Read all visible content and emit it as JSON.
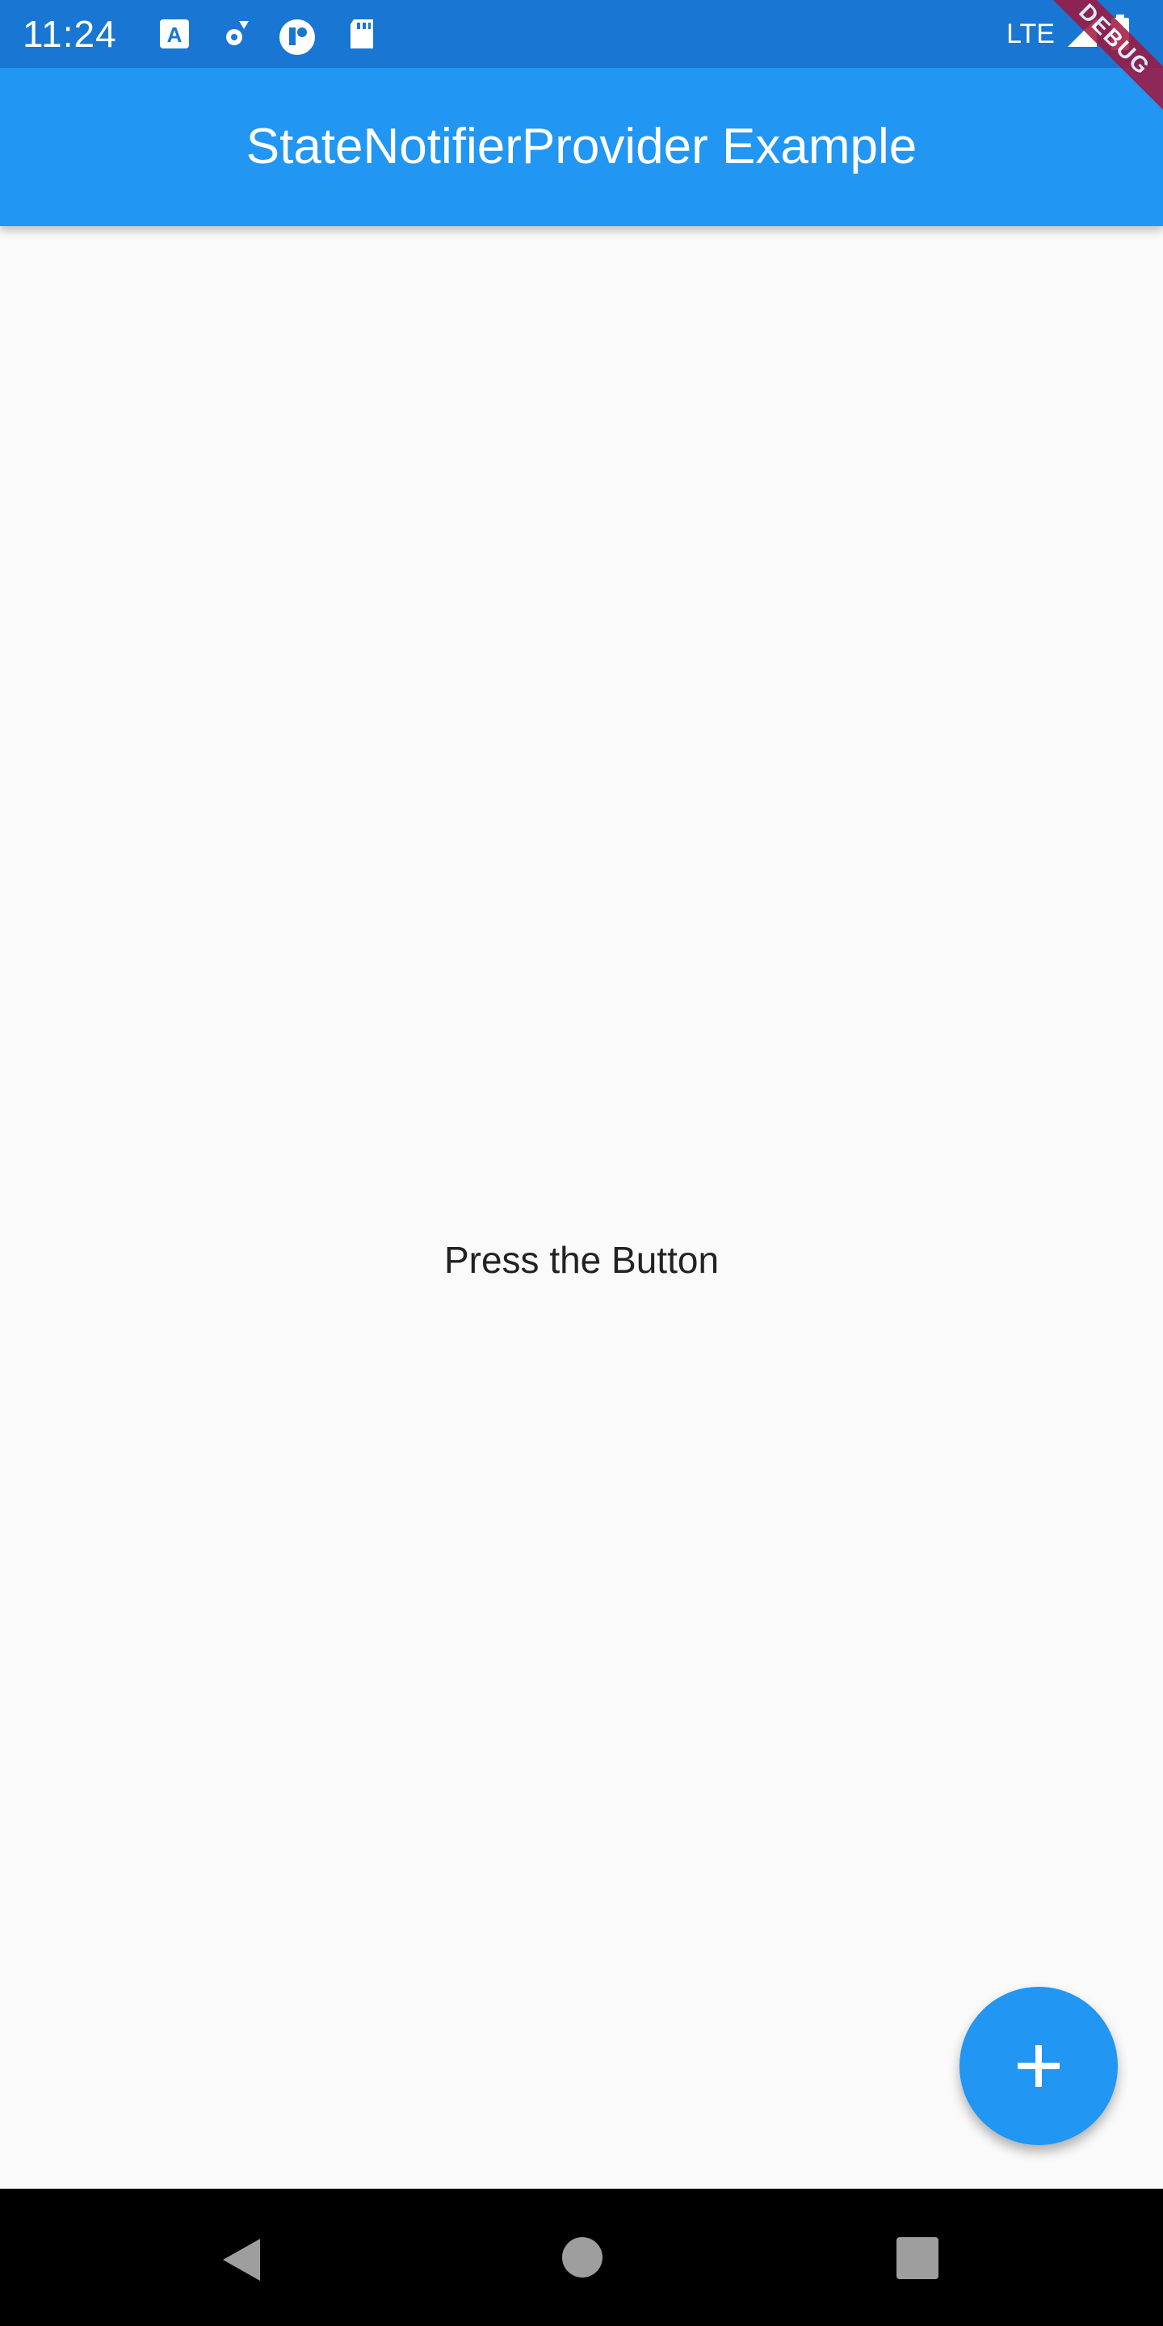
{
  "status_bar": {
    "time": "11:24",
    "network": "LTE",
    "icons": [
      "translate-icon",
      "settings-icon",
      "app-icon",
      "sd-card-icon",
      "signal-icon",
      "battery-icon"
    ],
    "background": "#1976d2"
  },
  "app_bar": {
    "title": "StateNotifierProvider Example",
    "background": "#2196f3"
  },
  "debug_banner": {
    "label": "DEBUG"
  },
  "body": {
    "message": "Press the Button"
  },
  "fab": {
    "icon": "plus-icon",
    "color": "#2196f3"
  },
  "nav_bar": {
    "icons": [
      "back-icon",
      "home-icon",
      "recents-icon"
    ]
  }
}
